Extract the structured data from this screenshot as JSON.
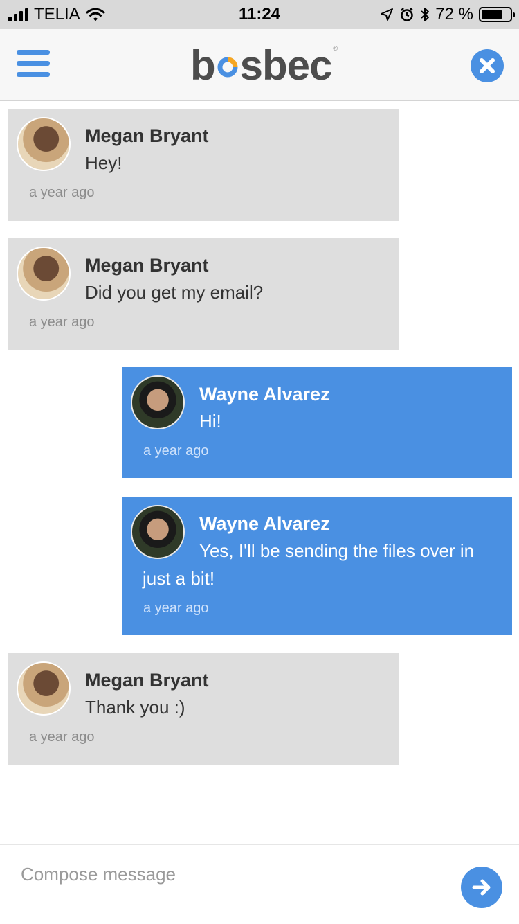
{
  "status_bar": {
    "carrier": "TELIA",
    "time": "11:24",
    "battery_percent": "72 %",
    "battery_level": 0.72,
    "icons": [
      "signal-icon",
      "wifi-icon",
      "location-icon",
      "alarm-icon",
      "bluetooth-icon",
      "battery-icon"
    ]
  },
  "header": {
    "logo_prefix": "b",
    "logo_suffix": "sbec",
    "logo_reg": "®",
    "menu_icon": "hamburger-menu-icon",
    "close_icon": "close-icon"
  },
  "colors": {
    "accent": "#4a90e2",
    "incoming_bubble": "#dedede",
    "status_bar": "#d9d9d9",
    "logo_ring": [
      "#4a90e2",
      "#f5a623"
    ]
  },
  "messages": [
    {
      "sender": "Megan Bryant",
      "text": "Hey!",
      "time": "a year ago",
      "direction": "incoming"
    },
    {
      "sender": "Megan Bryant",
      "text": "Did you get my email?",
      "time": "a year ago",
      "direction": "incoming"
    },
    {
      "sender": "Wayne Alvarez",
      "text": "Hi!",
      "time": "a year ago",
      "direction": "outgoing"
    },
    {
      "sender": "Wayne Alvarez",
      "text": "Yes, I'll be sending the files over in just a bit!",
      "time": "a year ago",
      "direction": "outgoing"
    },
    {
      "sender": "Megan Bryant",
      "text": "Thank you :)",
      "time": "a year ago",
      "direction": "incoming"
    }
  ],
  "compose": {
    "placeholder": "Compose message",
    "value": "",
    "send_icon": "arrow-right-icon"
  }
}
